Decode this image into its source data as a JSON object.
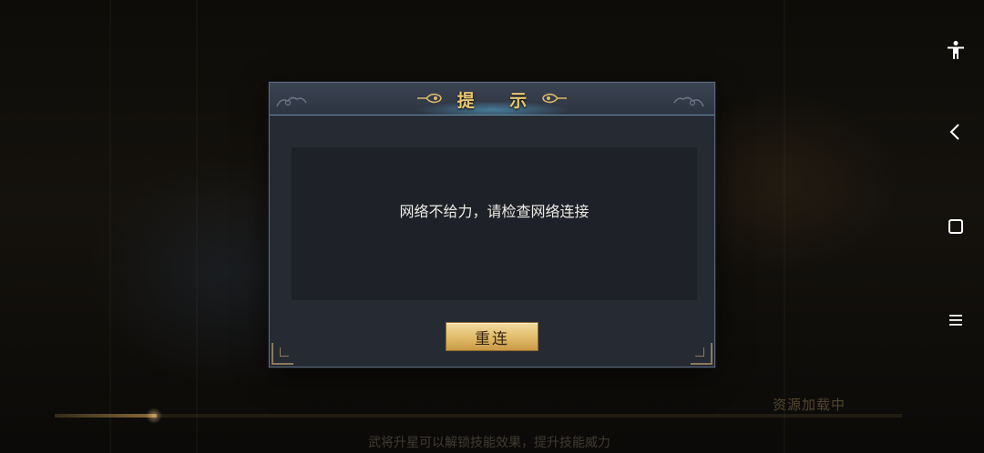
{
  "dialog": {
    "title": "提 示",
    "message": "网络不给力，请检查网络连接",
    "reconnect_label": "重连"
  },
  "background": {
    "loading_status": "资源加载中",
    "loading_tip": "武将升星可以解锁技能效果，提升技能威力",
    "loading_progress": 0.12
  },
  "system_nav": {
    "icons": [
      "accessibility-icon",
      "back-icon",
      "home-icon",
      "menu-icon"
    ]
  },
  "colors": {
    "title_gold": "#e9c772",
    "button_gold": "#e0bb6a",
    "dialog_bg": "#262a33",
    "body_bg": "#1e2128"
  }
}
